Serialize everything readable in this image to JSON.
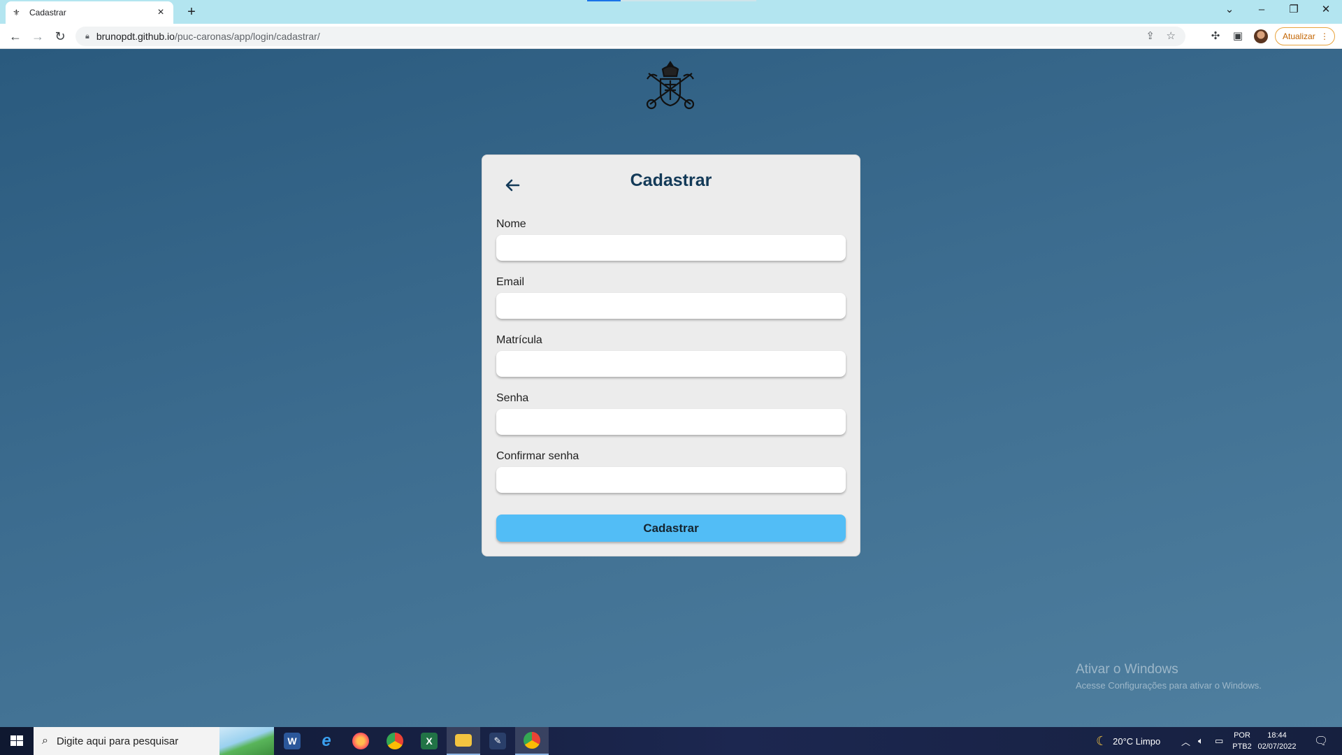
{
  "browser": {
    "tab_title": "Cadastrar",
    "new_tab": "+",
    "url_host": "brunopdt.github.io",
    "url_path": "/puc-caronas/app/login/cadastrar/",
    "update_label": "Atualizar"
  },
  "page": {
    "title": "Cadastrar",
    "fields": [
      {
        "label": "Nome",
        "value": ""
      },
      {
        "label": "Email",
        "value": ""
      },
      {
        "label": "Matrícula",
        "value": ""
      },
      {
        "label": "Senha",
        "value": ""
      },
      {
        "label": "Confirmar senha",
        "value": ""
      }
    ],
    "submit_label": "Cadastrar"
  },
  "watermark": {
    "line1": "Ativar o Windows",
    "line2": "Acesse Configurações para ativar o Windows."
  },
  "taskbar": {
    "search_placeholder": "Digite aqui para pesquisar",
    "weather": "20°C  Limpo",
    "lang_top": "POR",
    "lang_bottom": "PTB2",
    "time": "18:44",
    "date": "02/07/2022"
  },
  "colors": {
    "accent_button": "#52bdf6",
    "title_color": "#133a58",
    "page_bg": "#3c6c8f"
  }
}
